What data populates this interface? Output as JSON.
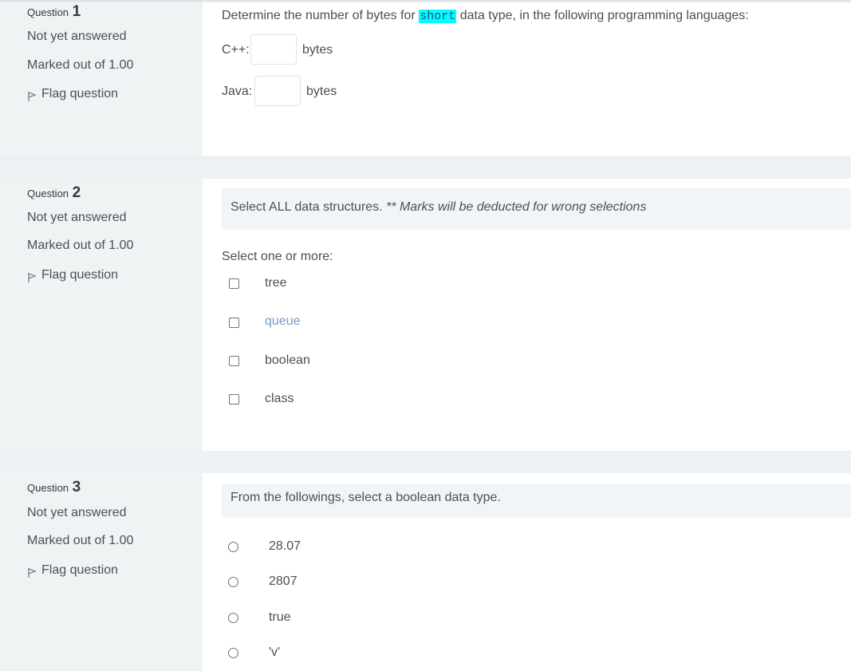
{
  "questions": [
    {
      "label": "Question",
      "number": "1",
      "state": "Not yet answered",
      "marks": "Marked out of 1.00",
      "flag_label": "Flag question",
      "text_before": "Determine the number of bytes for ",
      "code": "short",
      "text_after": " data type, in the following programming languages:",
      "fields": [
        {
          "label": "C++:",
          "value": "",
          "unit": "bytes"
        },
        {
          "label": "Java:",
          "value": "",
          "unit": "bytes"
        }
      ]
    },
    {
      "label": "Question",
      "number": "2",
      "state": "Not yet answered",
      "marks": "Marked out of 1.00",
      "flag_label": "Flag question",
      "text": "Select ALL data structures. ",
      "text_italic": "** Marks will be deducted for wrong selections",
      "prompt": "Select one or more:",
      "options": [
        {
          "label": "tree",
          "checked": false
        },
        {
          "label": "queue",
          "checked": false
        },
        {
          "label": "boolean",
          "checked": false
        },
        {
          "label": "class",
          "checked": false
        }
      ]
    },
    {
      "label": "Question",
      "number": "3",
      "state": "Not yet answered",
      "marks": "Marked out of 1.00",
      "flag_label": "Flag question",
      "text": "From the followings, select a boolean data type.",
      "options": [
        {
          "label": "28.07",
          "selected": false
        },
        {
          "label": "2807",
          "selected": false
        },
        {
          "label": "true",
          "selected": false
        },
        {
          "label": "'v'",
          "selected": false
        }
      ]
    }
  ]
}
